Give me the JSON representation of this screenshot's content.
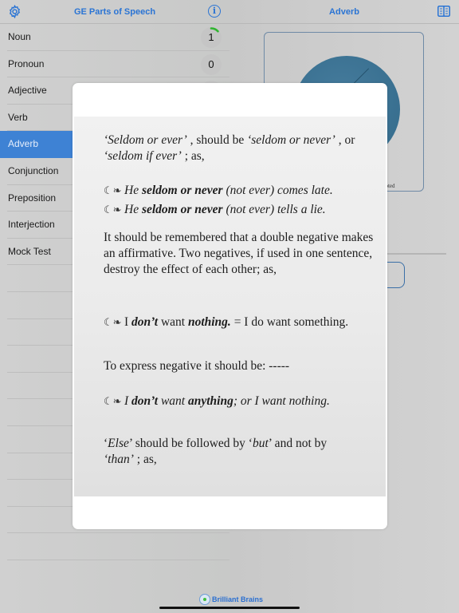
{
  "master": {
    "title": "GE Parts of Speech",
    "settings_icon": "gear-icon",
    "info_icon": "info-icon",
    "info_glyph": "i",
    "items": [
      {
        "label": "Noun",
        "count": "1",
        "progress": "partial"
      },
      {
        "label": "Pronoun",
        "count": "0"
      },
      {
        "label": "Adjective",
        "count": ""
      },
      {
        "label": "Verb",
        "count": ""
      },
      {
        "label": "Adverb",
        "count": "",
        "active": true
      },
      {
        "label": "Conjunction",
        "count": ""
      },
      {
        "label": "Preposition",
        "count": ""
      },
      {
        "label": "Interjection",
        "count": ""
      },
      {
        "label": "Mock Test",
        "count": ""
      }
    ],
    "empty_rows": 11
  },
  "detail": {
    "title": "Adverb",
    "book_icon": "book-icon",
    "chart_legend_fragment": "mpted"
  },
  "modal": {
    "p1": {
      "a": "‘Seldom or ever’",
      "b": " , should be ",
      "c": "‘seldom or never’",
      "d": " , or",
      "e": "‘seldom if ever’",
      "f": " ; as,"
    },
    "bullet_glyph": "•",
    "ex1": {
      "a": "He ",
      "b": "seldom or never",
      "c": " (not ever) comes late."
    },
    "ex2": {
      "a": "He ",
      "b": "seldom or never",
      "c": " (not ever) tells a lie."
    },
    "p2": "It should be remembered that a double negative makes an affirmative. Two negatives, if used in one sentence, destroy the effect of each other; as,",
    "ex3": {
      "a": "I ",
      "b": "don’t",
      "c": " want ",
      "d": "nothing.",
      "e": " = I do want something."
    },
    "p3": "To express negative it should be: -----",
    "ex4": {
      "a": "I ",
      "b": "don’t",
      "c": " want ",
      "d": "anything",
      "e": "; or I want nothing."
    },
    "p4": {
      "a": "‘",
      "b": "Else",
      "c": "’ should be followed by ‘",
      "d": "but",
      "e": "’ and not by",
      "f": "‘than’",
      "g": " ; as,"
    }
  },
  "footer": {
    "brand": "Brilliant Brains"
  }
}
